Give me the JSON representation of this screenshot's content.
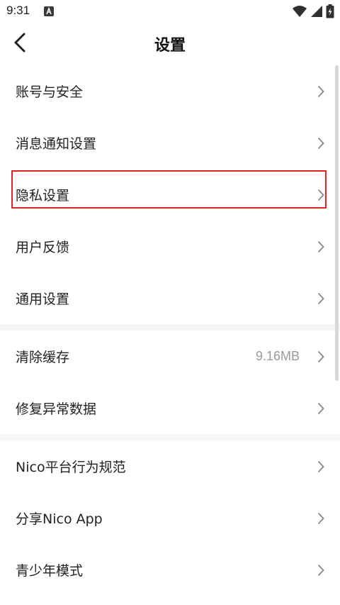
{
  "status_bar": {
    "time": "9:31",
    "icons": [
      "app-notification-icon",
      "wifi-icon",
      "cell-signal-icon",
      "battery-charging-icon"
    ]
  },
  "header": {
    "title": "设置",
    "back_icon": "chevron-left-icon"
  },
  "sections": [
    {
      "items": [
        {
          "label": "账号与安全"
        },
        {
          "label": "消息通知设置"
        },
        {
          "label": "隐私设置",
          "highlighted": true
        },
        {
          "label": "用户反馈"
        },
        {
          "label": "通用设置"
        }
      ]
    },
    {
      "items": [
        {
          "label": "清除缓存",
          "value": "9.16MB"
        },
        {
          "label": "修复异常数据"
        }
      ]
    },
    {
      "items": [
        {
          "label": "Nico平台行为规范"
        },
        {
          "label": "分享Nico App"
        },
        {
          "label": "青少年模式"
        }
      ]
    }
  ],
  "colors": {
    "highlight": "#e0242a",
    "chevron": "#888888",
    "section_gap": "#f6f6f6"
  }
}
